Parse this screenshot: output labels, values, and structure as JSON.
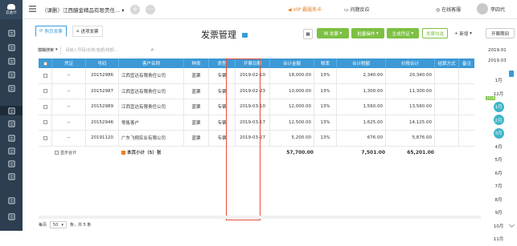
{
  "app": {
    "logo_text": "云会计",
    "brand_color": "#2c3e50"
  },
  "topbar": {
    "company": "（课删）江西臆金精品有限责任...",
    "vip_text": "VIP 霸服务卡",
    "customer_service": "问题反应",
    "online_service": "在线客服",
    "user": "李四代"
  },
  "tabs": [
    {
      "label": "购页发票"
    },
    {
      "label": "进项发票"
    }
  ],
  "page_title": "发票管理",
  "buttons": {
    "invoice": "发票",
    "batch": "批量操作",
    "generate": "生成凭证",
    "invoice_check": "发票勾选",
    "add": "新增",
    "period": "开票期间"
  },
  "search": {
    "select_label": "模糊搜索",
    "placeholder": "请输入号码/名称/金额/税额..."
  },
  "table": {
    "columns": [
      "凭证",
      "号码",
      "客户名称",
      "种类",
      "类型",
      "开票日期",
      "合计金额",
      "税率",
      "合计税额",
      "价税合计",
      "结算方式",
      "备注"
    ],
    "rows": [
      {
        "voucher": "--",
        "number": "20152986",
        "customer": "江西宜达有限责任公司",
        "kind": "蓝票",
        "type": "专票",
        "date": "2019-02-10",
        "amount": "18,000.00",
        "rate": "13%",
        "tax": "2,340.00",
        "total": "20,340.00",
        "settle": "",
        "note": ""
      },
      {
        "voucher": "--",
        "number": "20152987",
        "customer": "江西宜达有限责任公司",
        "kind": "蓝票",
        "type": "专票",
        "date": "2019-02-23",
        "amount": "10,000.00",
        "rate": "13%",
        "tax": "1,300.00",
        "total": "11,300.00",
        "settle": "",
        "note": ""
      },
      {
        "voucher": "--",
        "number": "20152989",
        "customer": "江西宜达有限责任公司",
        "kind": "蓝票",
        "type": "专票",
        "date": "2019-03-10",
        "amount": "12,000.00",
        "rate": "13%",
        "tax": "1,560.00",
        "total": "13,560.00",
        "settle": "",
        "note": ""
      },
      {
        "voucher": "--",
        "number": "20152946",
        "customer": "零售客户",
        "kind": "蓝票",
        "type": "专票",
        "date": "2019-03-17",
        "amount": "12,500.00",
        "rate": "13%",
        "tax": "1,625.00",
        "total": "14,125.00",
        "settle": "",
        "note": ""
      },
      {
        "voucher": "--",
        "number": "20191120",
        "customer": "广东飞翔实业有限公司",
        "kind": "蓝票",
        "type": "专票",
        "date": "2019-03-27",
        "amount": "5,200.00",
        "rate": "13%",
        "tax": "676.00",
        "total": "5,876.00",
        "settle": "",
        "note": ""
      }
    ],
    "footer": {
      "show_total": "显示合计",
      "subtotal": "本页小计（5）张",
      "amount": "57,700.00",
      "tax": "7,501.00",
      "total": "65,201.00"
    }
  },
  "pager": {
    "prefix": "每页",
    "page_size": "50",
    "suffix": "条，共 5 条"
  },
  "right_panel": {
    "from": "2019.01",
    "to": "2019.03",
    "year_badge": "2019",
    "months": [
      "1月",
      "12月",
      "1月",
      "2月",
      "3月",
      "4月",
      "5月",
      "6月",
      "7月",
      "8月",
      "9月",
      "10月",
      "11月"
    ]
  },
  "colors": {
    "accent": "#3c99d6",
    "green": "#7dc043",
    "highlight": "#e74c3c",
    "vip": "#e67e22"
  }
}
